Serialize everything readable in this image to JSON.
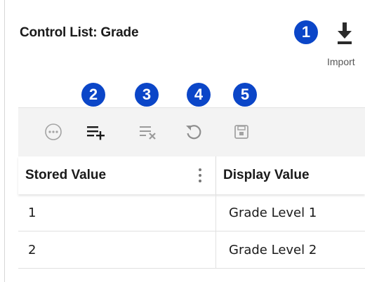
{
  "title": "Control List: Grade",
  "badges": [
    "1",
    "2",
    "3",
    "4",
    "5"
  ],
  "import": {
    "label": "Import",
    "icon": "download-icon"
  },
  "toolbar": {
    "icons": [
      "more-options-icon",
      "add-row-icon",
      "clear-rows-icon",
      "refresh-icon",
      "save-icon"
    ]
  },
  "table": {
    "columns": [
      "Stored Value",
      "Display Value"
    ],
    "rows": [
      {
        "stored": "1",
        "display": "Grade Level 1"
      },
      {
        "stored": "2",
        "display": "Grade Level 2"
      }
    ]
  },
  "colors": {
    "badge": "#0b46c8",
    "toolbar_bg": "#f3f3f3",
    "active_icon": "#1a1a1a",
    "disabled_icon": "#9a9a9a"
  }
}
